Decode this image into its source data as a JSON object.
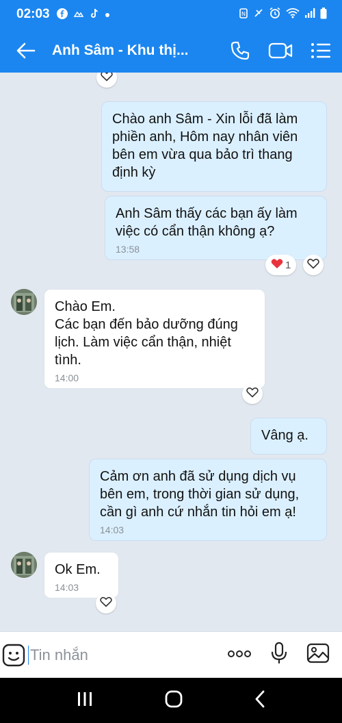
{
  "status_bar": {
    "time": "02:03",
    "left_icons": [
      "facebook-icon",
      "cloud-icon",
      "tiktok-icon",
      "dot-icon"
    ],
    "right_icons": [
      "nfc-icon",
      "mute-icon",
      "alarm-icon",
      "wifi-icon",
      "signal-icon",
      "battery-icon"
    ]
  },
  "header": {
    "title": "Anh Sâm - Khu thị...",
    "icons": [
      "back-arrow-icon",
      "phone-icon",
      "video-icon",
      "menu-icon"
    ]
  },
  "messages": [
    {
      "direction": "out",
      "text": "Chào anh Sâm - Xin lỗi đã làm\nphiền anh, Hôm nay nhân viên\nbên em vừa qua bảo trì thang\nđịnh kỳ",
      "time": ""
    },
    {
      "direction": "out",
      "text": "Anh Sâm thấy các bạn ấy làm\nviệc có cẩn thận không ạ?",
      "time": "13:58",
      "reaction_count": "1"
    },
    {
      "direction": "in",
      "text": "Chào Em.\nCác bạn đến bảo dưỡng đúng\nlịch. Làm việc cẩn thận, nhiệt\ntình.",
      "time": "14:00"
    },
    {
      "direction": "out",
      "text": "Vâng ạ.",
      "time": ""
    },
    {
      "direction": "out",
      "text": "Cảm ơn anh đã sử dụng dịch vụ\nbên em, trong thời gian sử dụng,\ncần gì anh cứ nhắn tin hỏi em ạ!",
      "time": "14:03"
    },
    {
      "direction": "in",
      "text": "Ok Em.",
      "time": "14:03"
    }
  ],
  "composer": {
    "placeholder": "Tin nhắn",
    "icons": [
      "emoji-icon",
      "more-options-icon",
      "microphone-icon",
      "image-icon"
    ]
  },
  "navbar": {
    "icons": [
      "recent-apps-icon",
      "home-icon",
      "back-icon"
    ]
  },
  "colors": {
    "header_blue": "#1b86f0",
    "outgoing_bubble": "#dbf0ff",
    "incoming_bubble": "#ffffff",
    "chat_background": "#e2e8f0",
    "heart_red": "#e8333d"
  }
}
